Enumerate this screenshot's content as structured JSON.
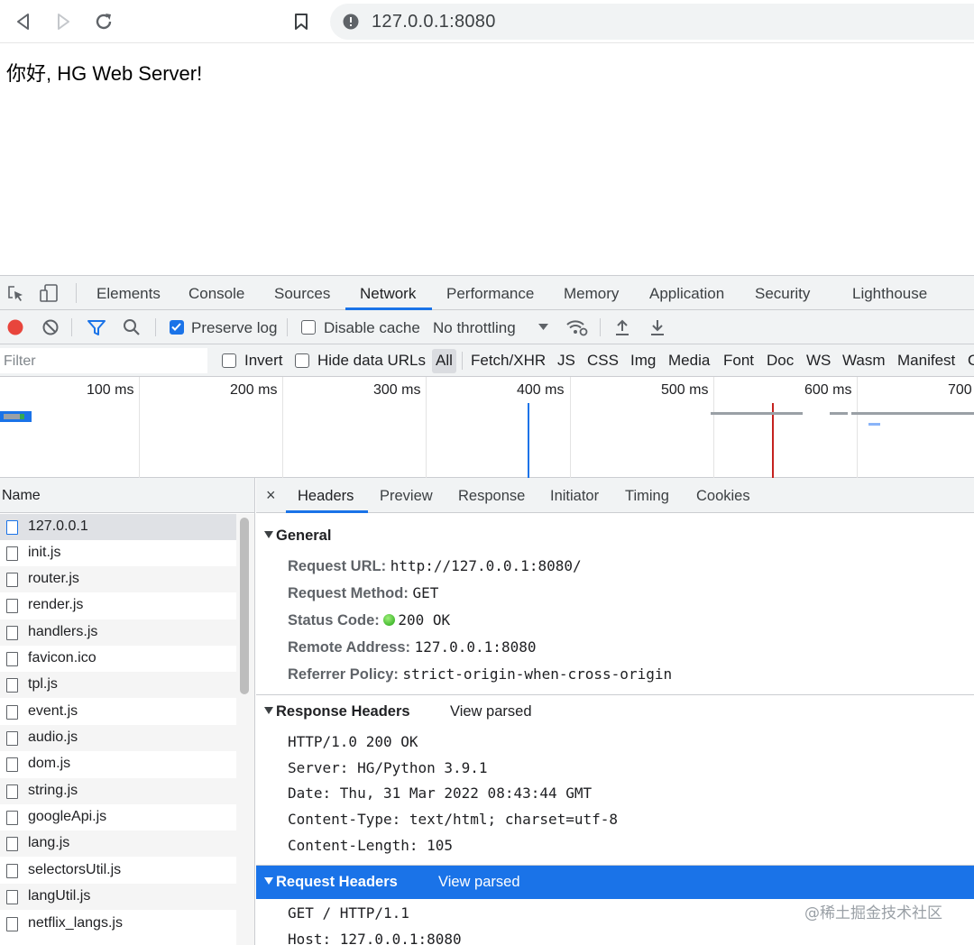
{
  "browser": {
    "url": "127.0.0.1:8080"
  },
  "page": {
    "greeting": "你好, HG Web Server!"
  },
  "devtools": {
    "tabs": [
      {
        "label": "Elements"
      },
      {
        "label": "Console"
      },
      {
        "label": "Sources"
      },
      {
        "label": "Network",
        "active": true
      },
      {
        "label": "Performance"
      },
      {
        "label": "Memory"
      },
      {
        "label": "Application"
      },
      {
        "label": "Security"
      },
      {
        "label": "Lighthouse"
      }
    ],
    "toolbar": {
      "preserve_log": "Preserve log",
      "preserve_log_checked": true,
      "disable_cache": "Disable cache",
      "disable_cache_checked": false,
      "throttling": "No throttling"
    },
    "filter": {
      "placeholder": "Filter",
      "invert": "Invert",
      "hide_data_urls": "Hide data URLs",
      "types": [
        "All",
        "Fetch/XHR",
        "JS",
        "CSS",
        "Img",
        "Media",
        "Font",
        "Doc",
        "WS",
        "Wasm",
        "Manifest",
        "O"
      ]
    },
    "overview": {
      "ticks": [
        "100 ms",
        "200 ms",
        "300 ms",
        "400 ms",
        "500 ms",
        "600 ms",
        "700"
      ]
    },
    "request_list": {
      "header": "Name",
      "items": [
        {
          "name": "127.0.0.1",
          "type": "doc",
          "selected": true
        },
        {
          "name": "init.js"
        },
        {
          "name": "router.js"
        },
        {
          "name": "render.js"
        },
        {
          "name": "handlers.js"
        },
        {
          "name": "favicon.ico"
        },
        {
          "name": "tpl.js"
        },
        {
          "name": "event.js"
        },
        {
          "name": "audio.js"
        },
        {
          "name": "dom.js"
        },
        {
          "name": "string.js"
        },
        {
          "name": "googleApi.js"
        },
        {
          "name": "lang.js"
        },
        {
          "name": "selectorsUtil.js"
        },
        {
          "name": "langUtil.js"
        },
        {
          "name": "netflix_langs.js"
        }
      ]
    },
    "detail": {
      "close": "×",
      "tabs": [
        "Headers",
        "Preview",
        "Response",
        "Initiator",
        "Timing",
        "Cookies"
      ],
      "general": {
        "title": "General",
        "request_url_label": "Request URL:",
        "request_url": "http://127.0.0.1:8080/",
        "request_method_label": "Request Method:",
        "request_method": "GET",
        "status_code_label": "Status Code:",
        "status_code": "200 OK",
        "status_color": "#21a313",
        "remote_address_label": "Remote Address:",
        "remote_address": "127.0.0.1:8080",
        "referrer_policy_label": "Referrer Policy:",
        "referrer_policy": "strict-origin-when-cross-origin"
      },
      "response_headers": {
        "title": "Response Headers",
        "view_parsed": "View parsed",
        "lines": [
          "HTTP/1.0 200 OK",
          "Server: HG/Python 3.9.1",
          "Date: Thu, 31 Mar 2022 08:43:44 GMT",
          "Content-Type: text/html; charset=utf-8",
          "Content-Length: 105"
        ]
      },
      "request_headers": {
        "title": "Request Headers",
        "view_parsed": "View parsed",
        "lines": [
          "GET / HTTP/1.1",
          "Host: 127.0.0.1:8080"
        ]
      }
    }
  },
  "watermark": "@稀土掘金技术社区",
  "colors": {
    "accent": "#1a73e8",
    "record": "#e8453c"
  }
}
